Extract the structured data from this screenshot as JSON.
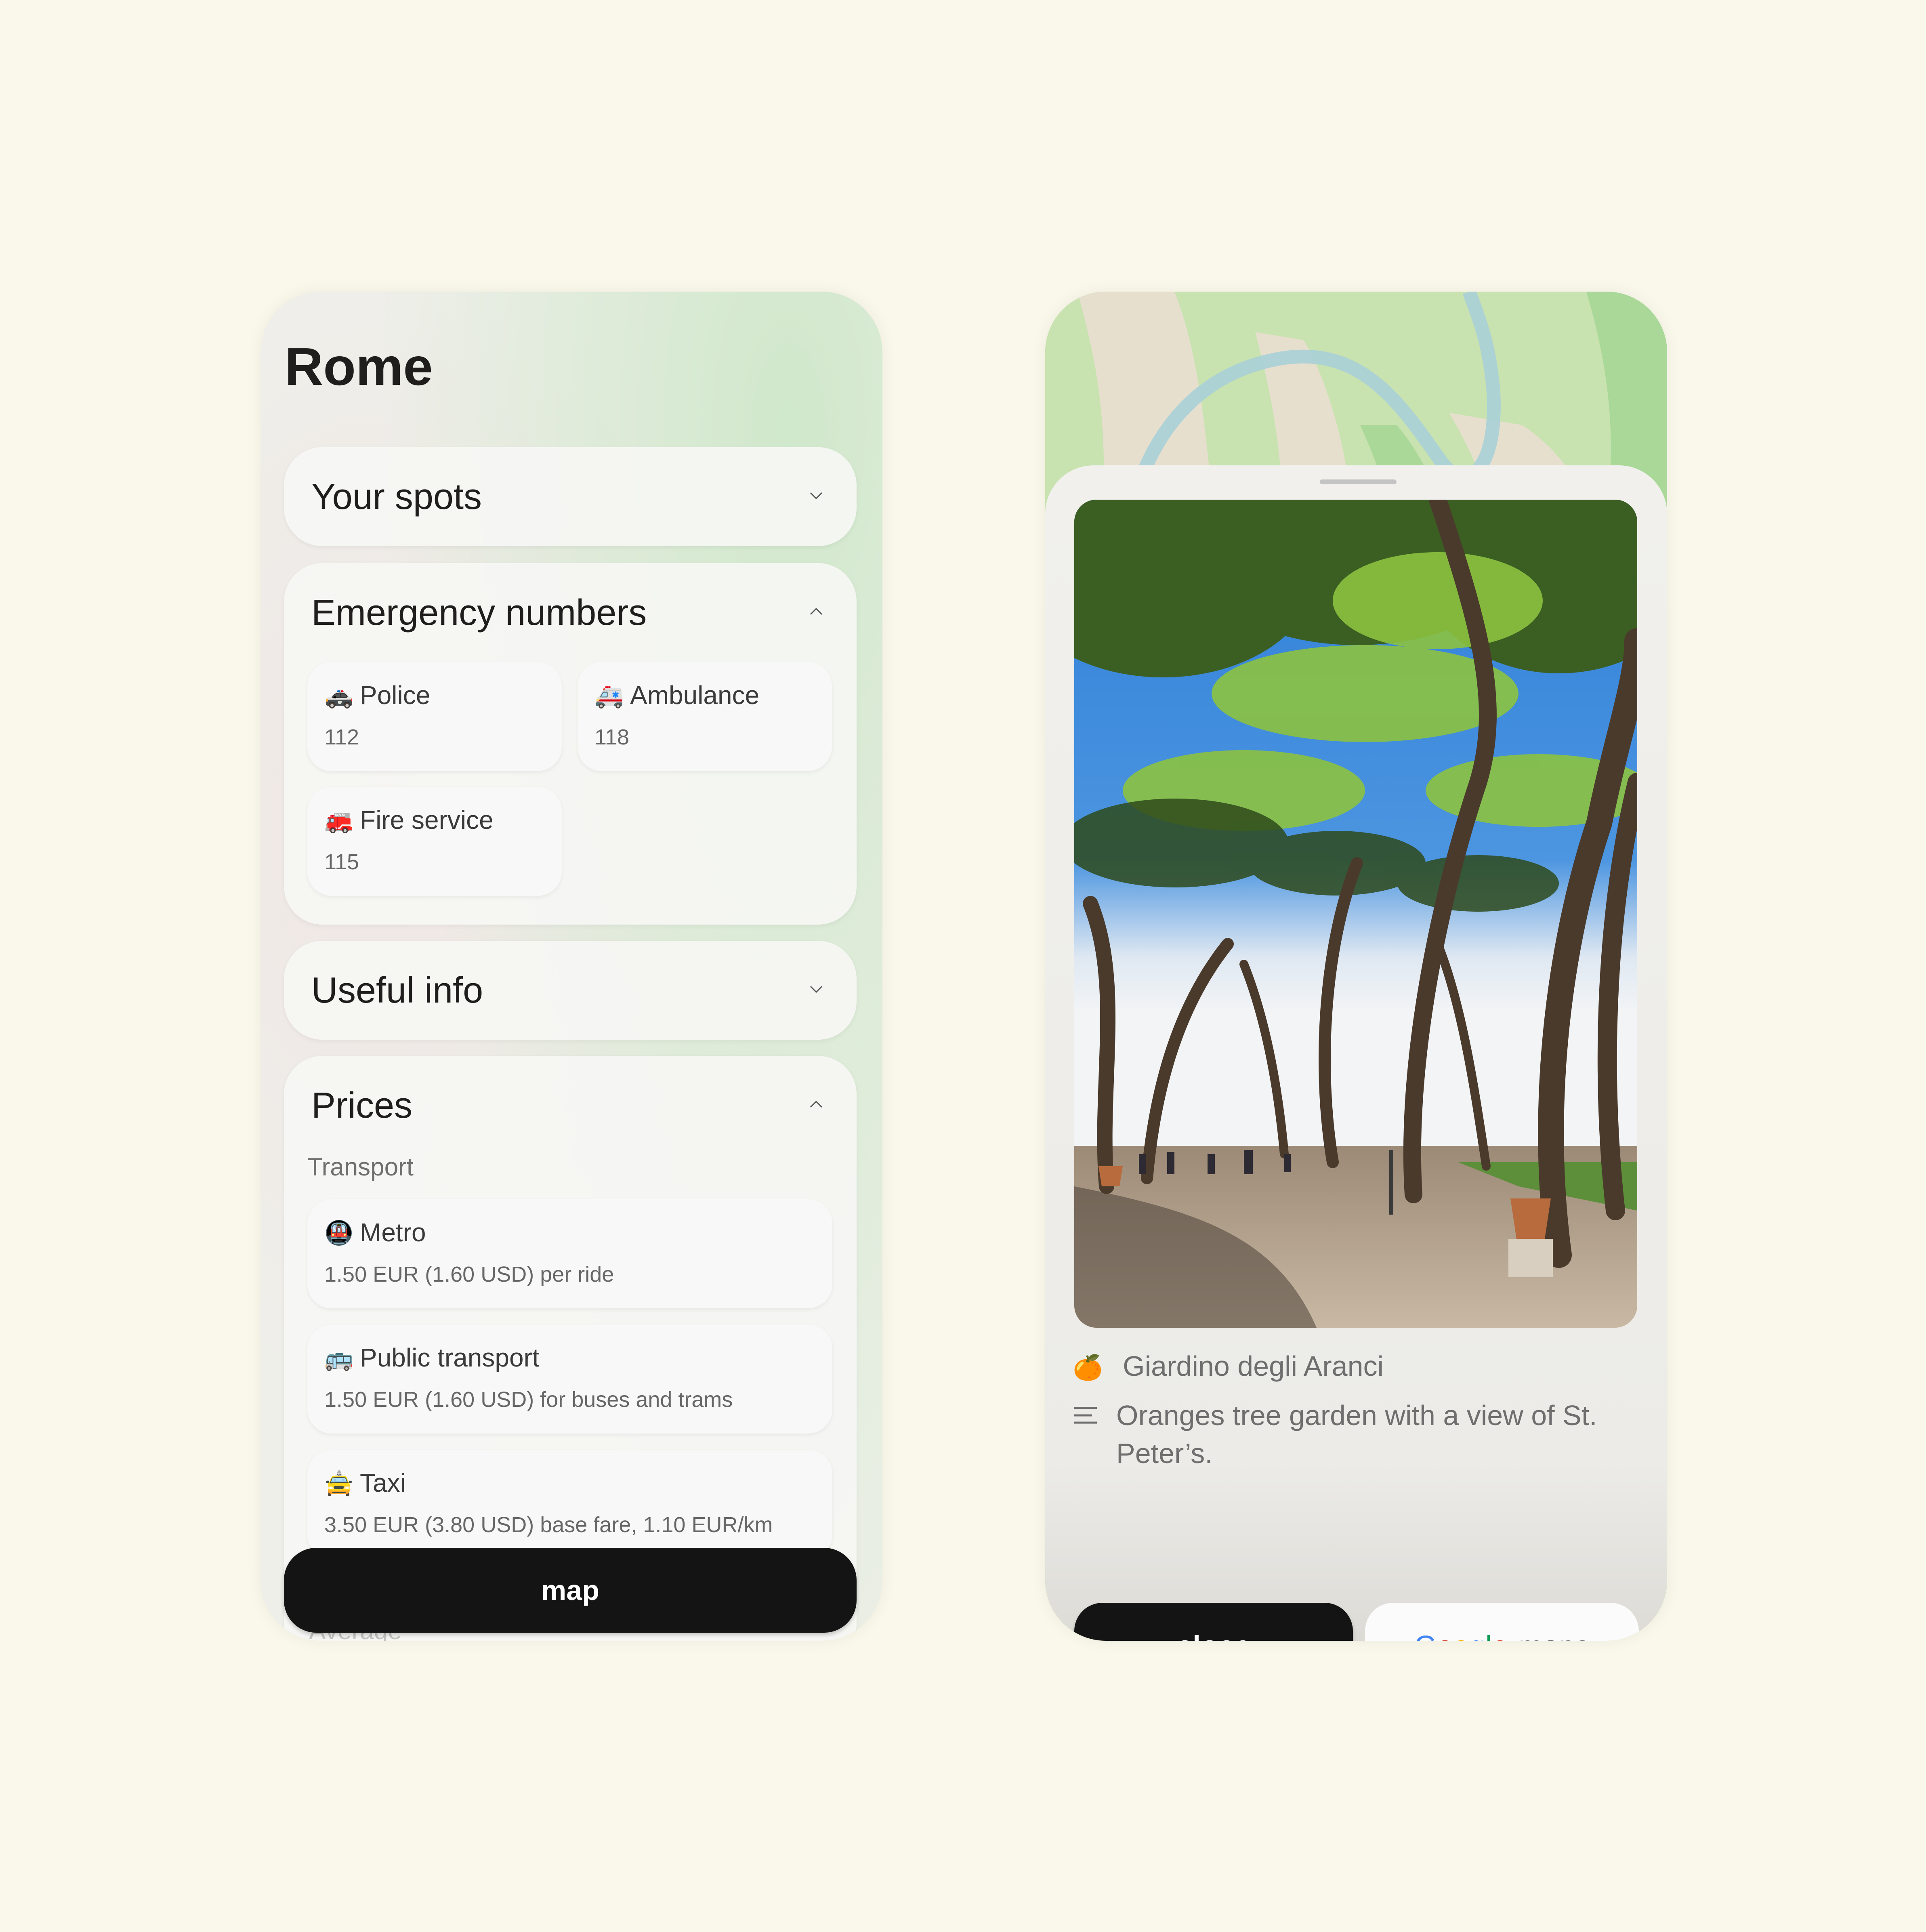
{
  "left_screen": {
    "title": "Rome",
    "sections": {
      "your_spots": {
        "title": "Your spots",
        "state": "collapsed",
        "icon": "chevron-down-icon"
      },
      "emergency": {
        "title": "Emergency numbers",
        "state": "expanded",
        "icon": "chevron-up-icon",
        "items": [
          {
            "emoji": "🚓",
            "icon": "police-car-icon",
            "label": "Police",
            "number": "112"
          },
          {
            "emoji": "🚑",
            "icon": "ambulance-icon",
            "label": "Ambulance",
            "number": "118"
          },
          {
            "emoji": "🚒",
            "icon": "fire-engine-icon",
            "label": "Fire service",
            "number": "115"
          }
        ]
      },
      "useful_info": {
        "title": "Useful info",
        "state": "collapsed",
        "icon": "chevron-down-icon"
      },
      "prices": {
        "title": "Prices",
        "state": "expanded",
        "icon": "chevron-up-icon",
        "subsection": "Transport",
        "items": [
          {
            "emoji": "🚇",
            "icon": "metro-icon",
            "label": "Metro",
            "price": "1.50 EUR (1.60 USD) per ride"
          },
          {
            "emoji": "🚌",
            "icon": "bus-icon",
            "label": "Public transport",
            "price": "1.50 EUR (1.60 USD) for buses and trams"
          },
          {
            "emoji": "🚖",
            "icon": "taxi-icon",
            "label": "Taxi",
            "price": "3.50 EUR (3.80 USD) base fare, 1.10 EUR/km"
          }
        ],
        "next_subsection_partial": "Average"
      }
    },
    "map_button": "map"
  },
  "right_screen": {
    "place": {
      "emoji": "🍊",
      "icon": "orange-icon",
      "name": "Giardino degli Aranci"
    },
    "description": {
      "icon": "text-lines-icon",
      "text": "Oranges tree garden with a view of St. Peter’s."
    },
    "photo_alt": "Stone pine trees in a park with people walking, blue sky",
    "buttons": {
      "close": "close",
      "google": {
        "letters": [
          "G",
          "o",
          "o",
          "g",
          "l",
          "e"
        ],
        "suffix": "maps"
      }
    },
    "colors": {
      "google_blue": "#4285f4",
      "google_red": "#db4437",
      "google_yellow": "#f4b400",
      "google_green": "#0f9d58"
    }
  }
}
